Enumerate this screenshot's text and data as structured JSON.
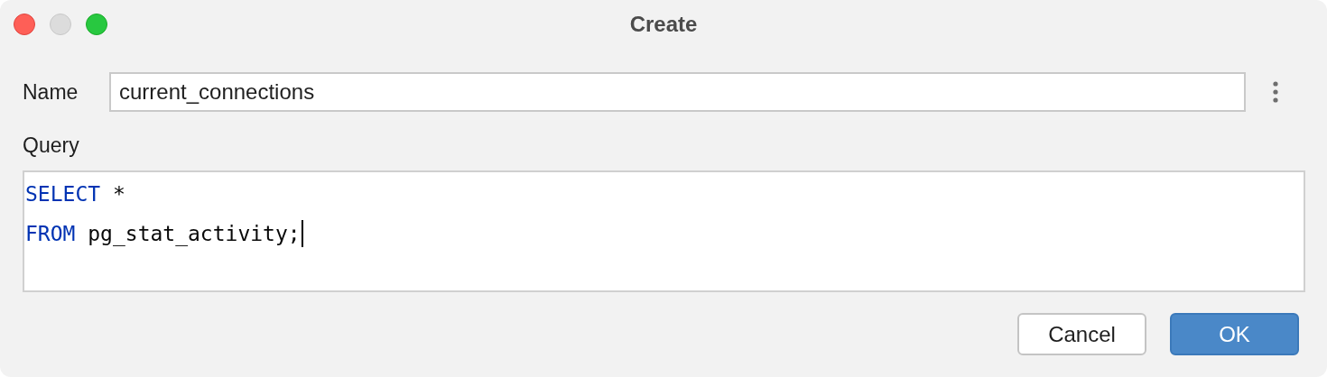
{
  "window": {
    "title": "Create"
  },
  "name_field": {
    "label": "Name",
    "value": "current_connections"
  },
  "query": {
    "label": "Query",
    "lines": [
      {
        "caret": false,
        "tokens": [
          {
            "kind": "keyword",
            "text": "SELECT"
          },
          {
            "kind": "plain",
            "text": " *"
          }
        ]
      },
      {
        "caret": true,
        "tokens": [
          {
            "kind": "keyword",
            "text": "FROM"
          },
          {
            "kind": "plain",
            "text": " pg_stat_activity;"
          }
        ]
      }
    ]
  },
  "buttons": [
    {
      "label": "Cancel",
      "kind": "secondary"
    },
    {
      "label": "OK",
      "kind": "primary"
    }
  ]
}
